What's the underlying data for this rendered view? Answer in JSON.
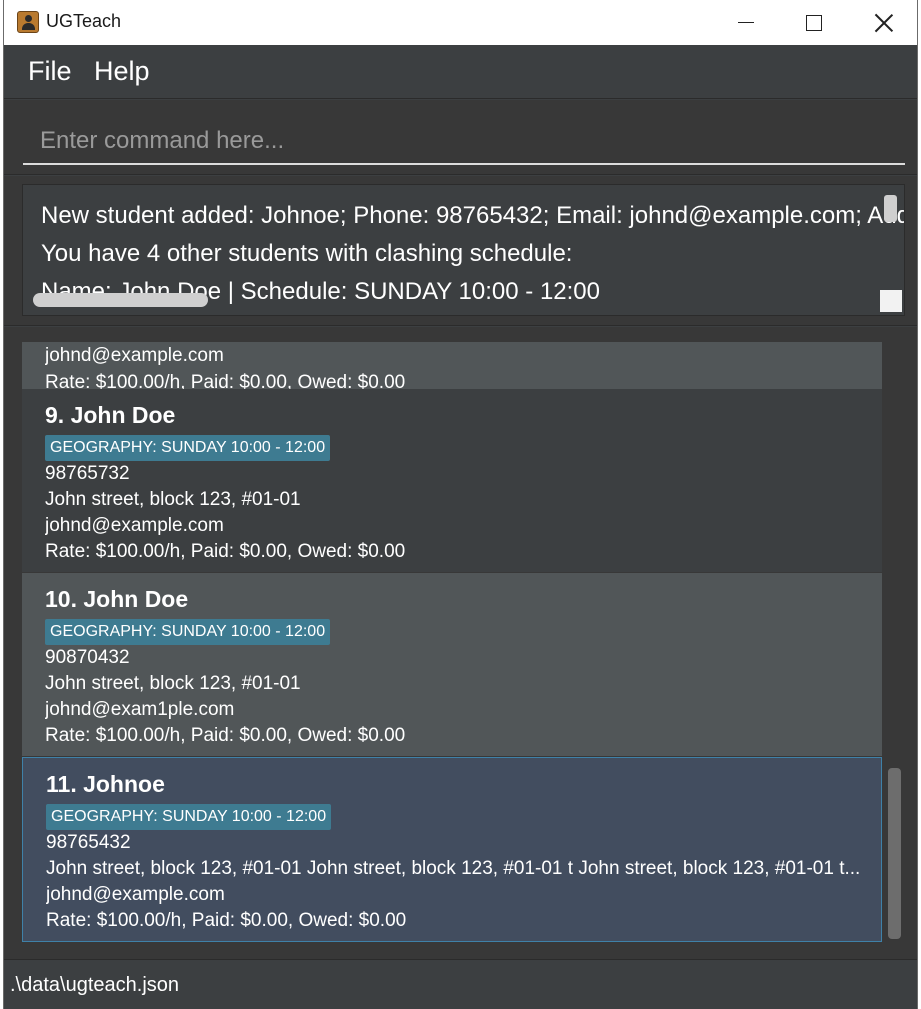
{
  "window": {
    "title": "UGTeach"
  },
  "menu": {
    "file": "File",
    "help": "Help"
  },
  "command": {
    "placeholder": "Enter command here...",
    "value": ""
  },
  "result": {
    "line1": "New student added: Johnoe; Phone: 98765432; Email: johnd@example.com; Address: John street",
    "line2": "You have 4 other students with clashing schedule:",
    "line3": "Name: John Doe | Schedule: SUNDAY 10:00 - 12:00"
  },
  "students": [
    {
      "title": "",
      "tag": "",
      "phone": "",
      "address": "",
      "email": "johnd@example.com",
      "rate": "Rate: $100.00/h, Paid: $0.00, Owed: $0.00"
    },
    {
      "title": "9. John Doe",
      "tag": "GEOGRAPHY: SUNDAY 10:00 - 12:00",
      "phone": "98765732",
      "address": "John street, block 123, #01-01",
      "email": "johnd@example.com",
      "rate": "Rate: $100.00/h, Paid: $0.00, Owed: $0.00"
    },
    {
      "title": "10. John Doe",
      "tag": "GEOGRAPHY: SUNDAY 10:00 - 12:00",
      "phone": "90870432",
      "address": "John street, block 123, #01-01",
      "email": "johnd@exam1ple.com",
      "rate": "Rate: $100.00/h, Paid: $0.00, Owed: $0.00"
    },
    {
      "title": "11. Johnoe",
      "tag": "GEOGRAPHY: SUNDAY 10:00 - 12:00",
      "phone": "98765432",
      "address": "John street, block 123, #01-01 John street, block 123, #01-01 t John street, block 123, #01-01 t...",
      "email": "johnd@example.com",
      "rate": "Rate: $100.00/h, Paid: $0.00, Owed: $0.00"
    }
  ],
  "status": {
    "path": ".\\data\\ugteach.json"
  }
}
